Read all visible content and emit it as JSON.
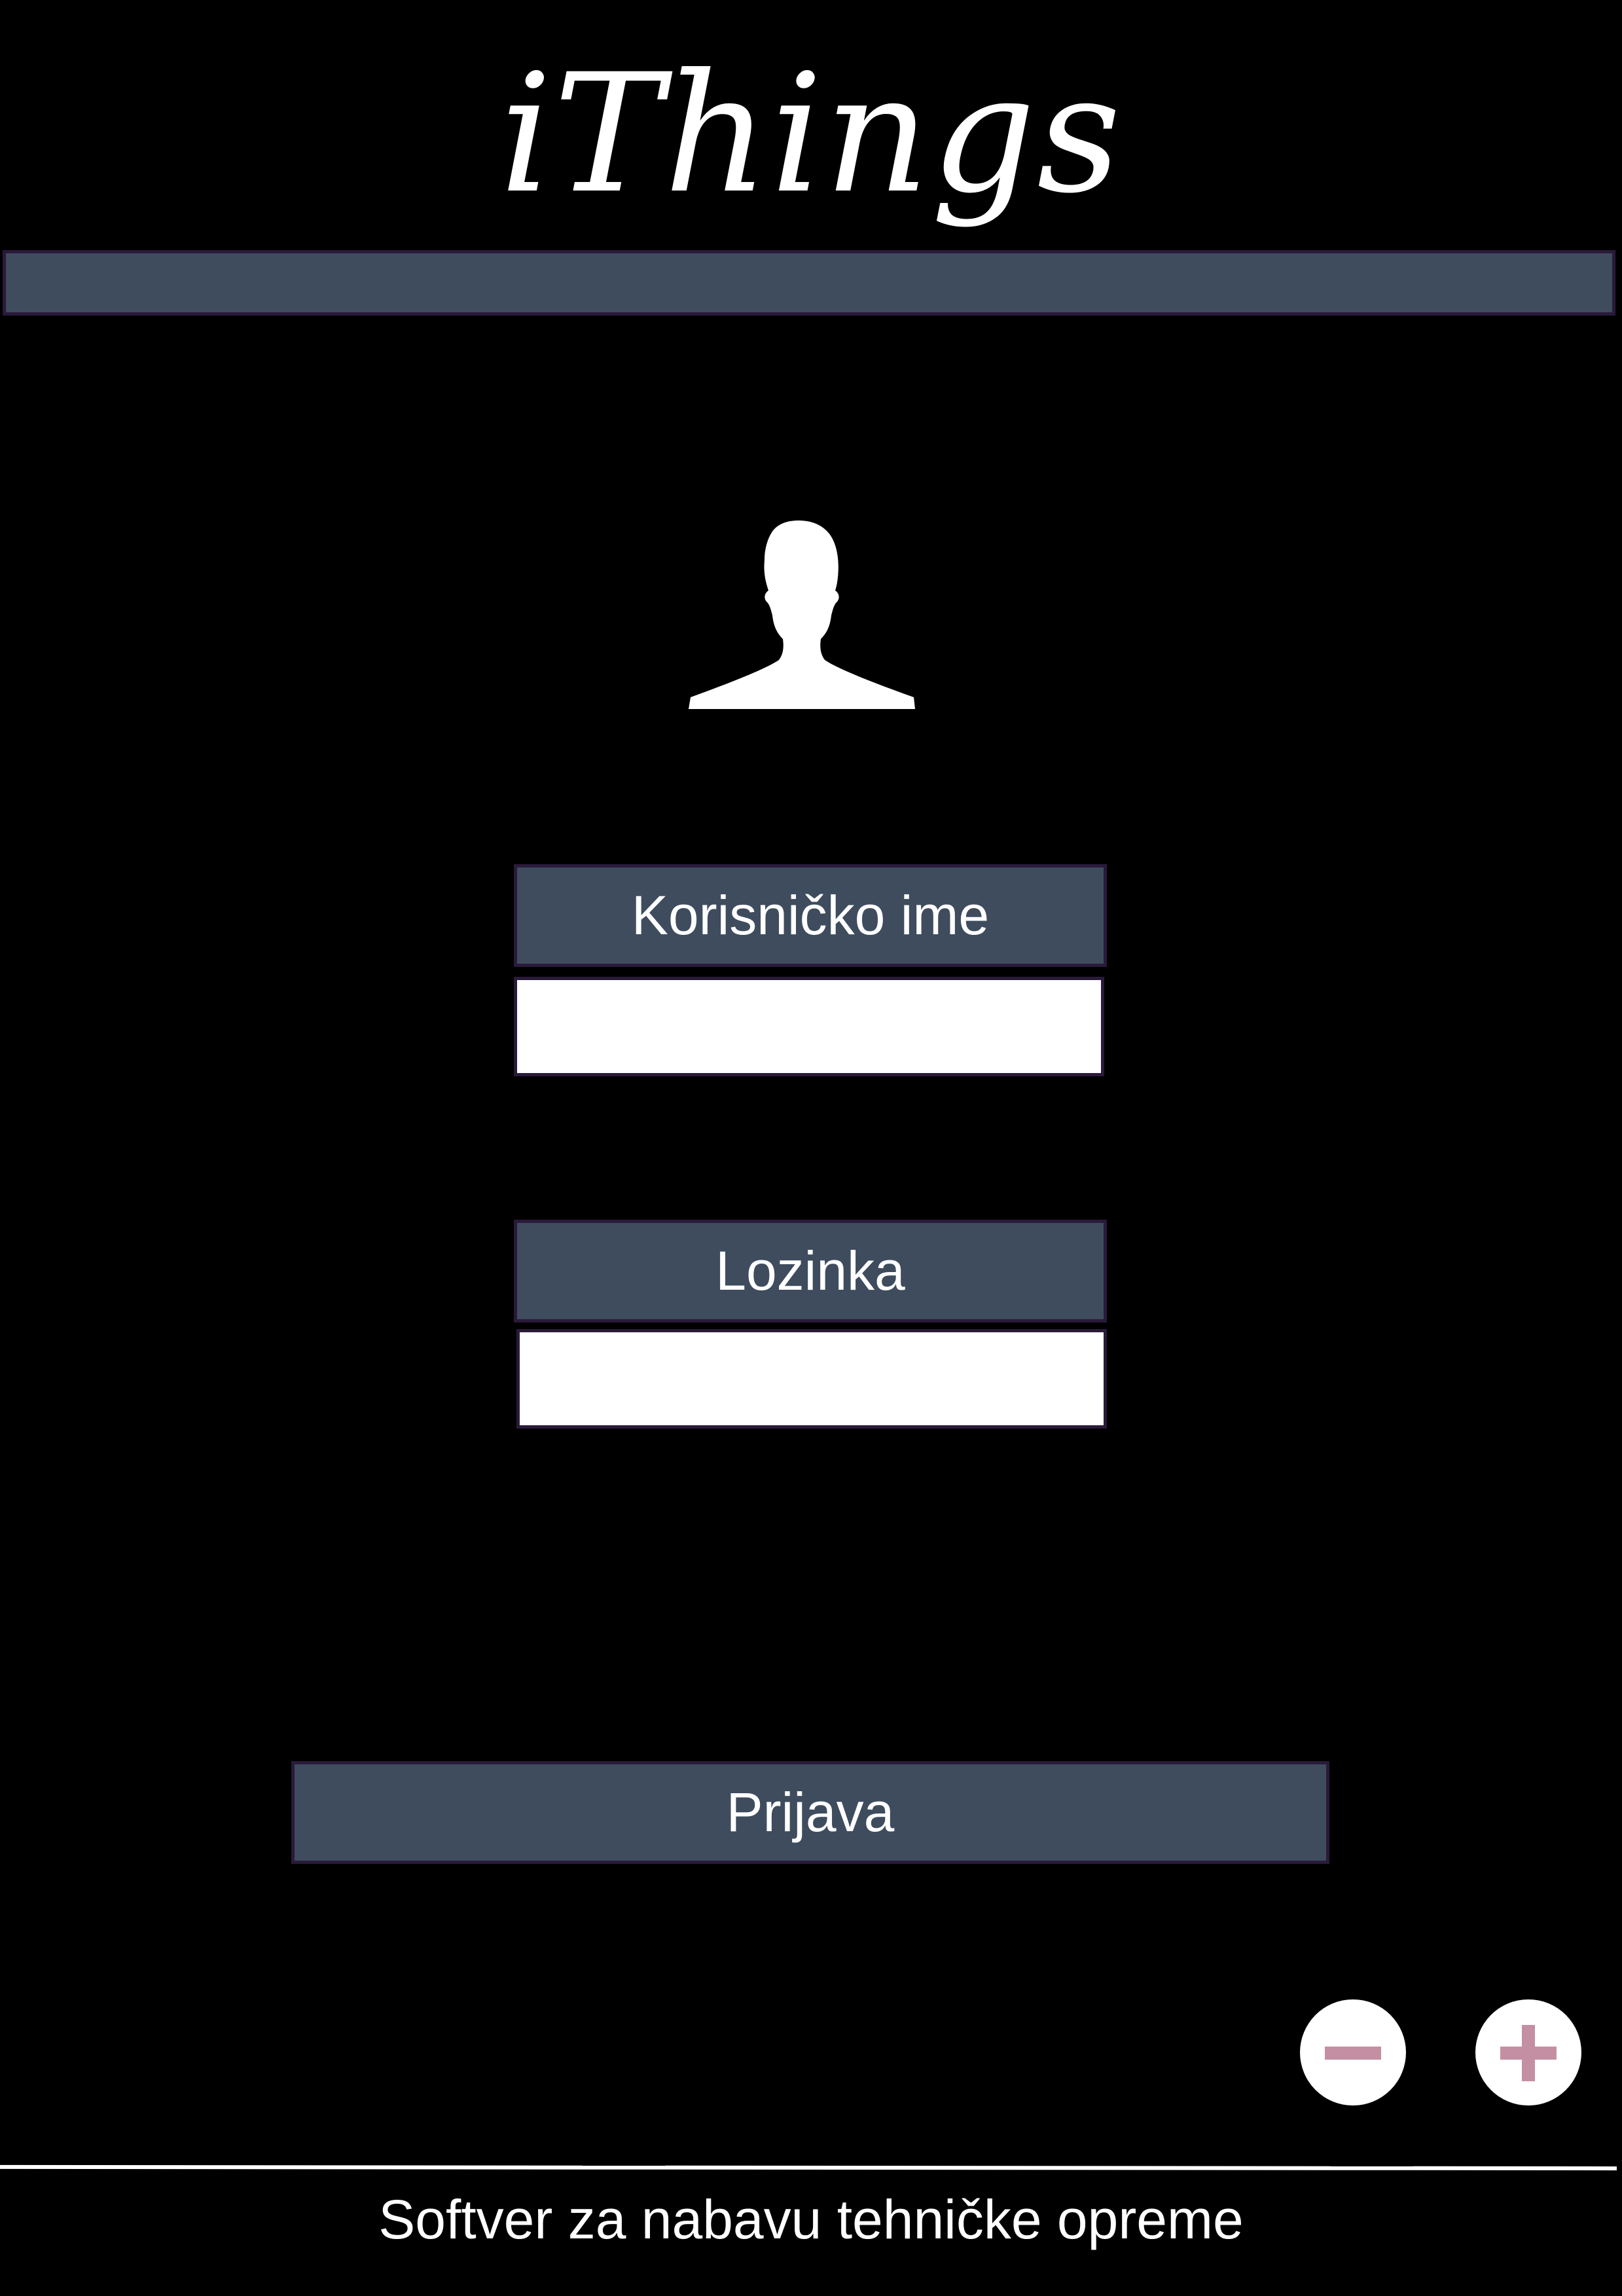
{
  "app": {
    "logo_text": "iThings"
  },
  "login_form": {
    "username_label": "Korisničko ime",
    "username_value": "",
    "password_label": "Lozinka",
    "password_value": "",
    "submit_label": "Prijava"
  },
  "zoom_controls": {
    "zoom_out_icon": "minus-icon",
    "zoom_in_icon": "plus-icon",
    "icon_color": "#c48fa3"
  },
  "footer": {
    "tagline": "Softver za nabavu tehničke opreme"
  },
  "colors": {
    "background": "#000000",
    "panel": "#3e4c5e",
    "border": "#2a1a3a",
    "text": "#ffffff"
  }
}
